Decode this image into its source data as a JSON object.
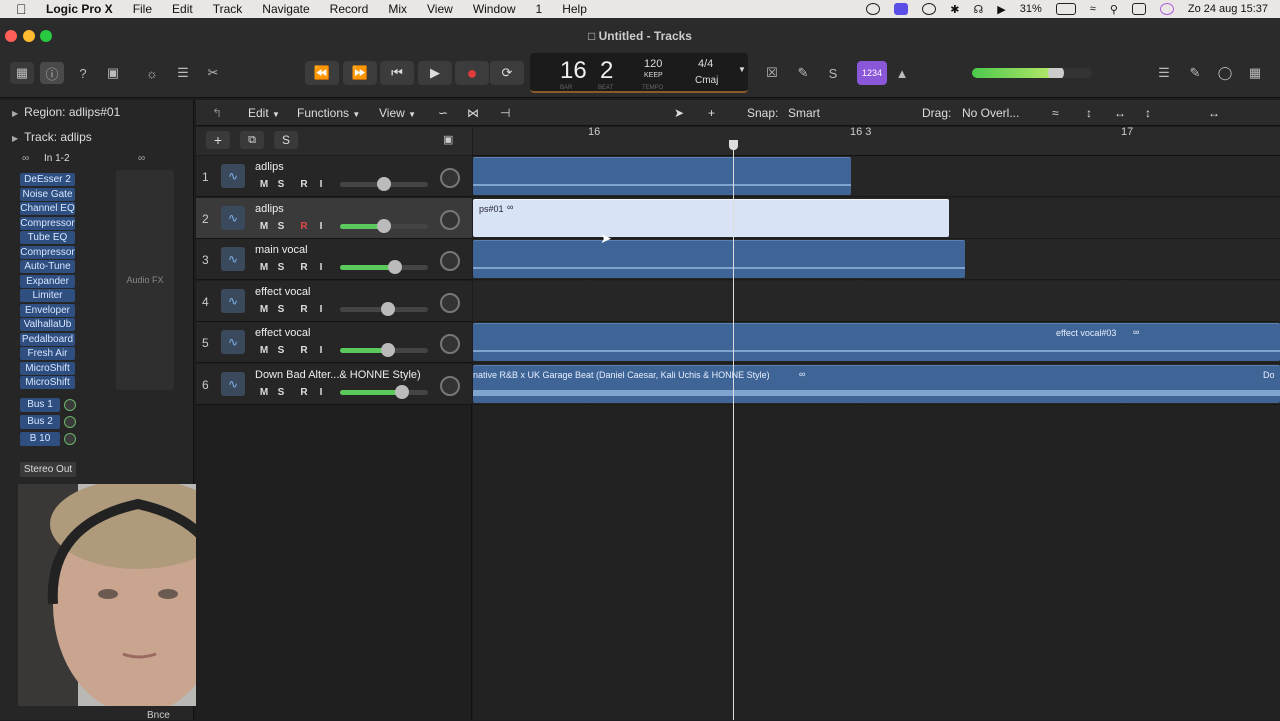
{
  "menubar": {
    "app": "Logic Pro X",
    "items": [
      "File",
      "Edit",
      "Track",
      "Navigate",
      "Record",
      "Mix",
      "View",
      "Window",
      "1",
      "Help"
    ],
    "battery": "31%",
    "datetime": "Zo 24 aug  15:37"
  },
  "window": {
    "title": "Untitled - Tracks"
  },
  "lcd": {
    "bar": "16",
    "beat": "2",
    "bar_label": "BAR",
    "beat_label": "BEAT",
    "tempo": "120",
    "tempo_mode": "KEEP",
    "tempo_label": "TEMPO",
    "signature": "4/4",
    "key": "Cmaj",
    "mode_button": "1234"
  },
  "inspector": {
    "region_label": "Region:",
    "region_name": "adlips#01",
    "track_label": "Track:",
    "track_name": "adlips",
    "input": "In 1-2",
    "plugins": [
      "DeEsser 2",
      "Noise Gate",
      "Channel EQ",
      "Compressor",
      "Tube EQ",
      "Compressor",
      "Auto-Tune",
      "Expander",
      "Limiter",
      "Enveloper",
      "ValhallaUb",
      "Pedalboard",
      "Fresh Air",
      "MicroShift",
      "MicroShift"
    ],
    "buses": [
      "Bus 1",
      "Bus 2",
      "B 10"
    ],
    "audio_fx": "Audio FX",
    "output": "Stereo Out",
    "bottom_label": "Bnce"
  },
  "lower_toolbar": {
    "edit": "Edit",
    "functions": "Functions",
    "view": "View",
    "snap_label": "Snap:",
    "snap_value": "Smart",
    "drag_label": "Drag:",
    "drag_value": "No Overl..."
  },
  "header_tools": {
    "s_label": "S"
  },
  "ruler": {
    "marks": [
      "16",
      "16 3",
      "17"
    ]
  },
  "tracks": [
    {
      "num": "1",
      "name": "adlips",
      "level": 0.5,
      "mute": "M",
      "solo": "S",
      "rec": "R",
      "input": "I"
    },
    {
      "num": "2",
      "name": "adlips",
      "level": 0.5,
      "mute": "M",
      "solo": "S",
      "rec": "R",
      "input": "I"
    },
    {
      "num": "3",
      "name": "main vocal",
      "level": 0.62,
      "mute": "M",
      "solo": "S",
      "rec": "R",
      "input": "I"
    },
    {
      "num": "4",
      "name": "effect vocal",
      "level": 0.55,
      "mute": "M",
      "solo": "S",
      "rec": "R",
      "input": "I"
    },
    {
      "num": "5",
      "name": "effect vocal",
      "level": 0.55,
      "mute": "M",
      "solo": "S",
      "rec": "R",
      "input": "I"
    },
    {
      "num": "6",
      "name": "Down Bad   Alter...& HONNE Style)",
      "level": 0.7,
      "mute": "M",
      "solo": "S",
      "rec": "R",
      "input": "I"
    }
  ],
  "regions": {
    "r2": "ps#01",
    "r5": "effect vocal#03",
    "r6a": "native R&B x UK Garage Beat (Daniel Caesar, Kali Uchis & HONNE Style)",
    "r6b": "Do"
  }
}
